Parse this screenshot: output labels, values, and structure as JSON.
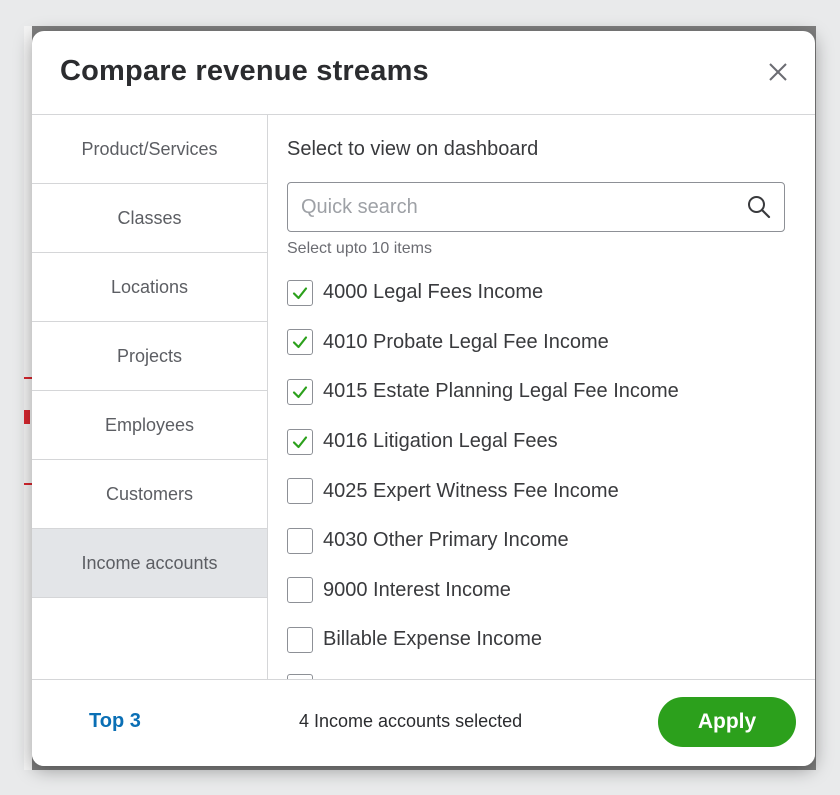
{
  "modal": {
    "title": "Compare revenue streams",
    "close_icon": "close-icon"
  },
  "categories": [
    {
      "label": "Product/Services",
      "active": false
    },
    {
      "label": "Classes",
      "active": false
    },
    {
      "label": "Locations",
      "active": false
    },
    {
      "label": "Projects",
      "active": false
    },
    {
      "label": "Employees",
      "active": false
    },
    {
      "label": "Customers",
      "active": false
    },
    {
      "label": "Income accounts",
      "active": true
    }
  ],
  "panel": {
    "heading": "Select to view on dashboard",
    "search_placeholder": "Quick search",
    "search_value": "",
    "search_icon": "search-icon",
    "hint": "Select upto 10 items"
  },
  "accounts": [
    {
      "label": "4000 Legal Fees Income",
      "checked": true
    },
    {
      "label": "4010 Probate Legal Fee Income",
      "checked": true
    },
    {
      "label": "4015 Estate Planning Legal Fee Income",
      "checked": true
    },
    {
      "label": "4016 Litigation Legal Fees",
      "checked": true
    },
    {
      "label": "4025 Expert Witness Fee Income",
      "checked": false
    },
    {
      "label": "4030 Other Primary Income",
      "checked": false
    },
    {
      "label": "9000 Interest Income",
      "checked": false
    },
    {
      "label": "Billable Expense Income",
      "checked": false
    }
  ],
  "footer": {
    "top3_label": "Top 3",
    "selected_text": "4 Income accounts selected",
    "apply_label": "Apply"
  },
  "colors": {
    "accent_green": "#2ca01c",
    "link_blue": "#0a6fb5",
    "check_green": "#2ca01c"
  }
}
